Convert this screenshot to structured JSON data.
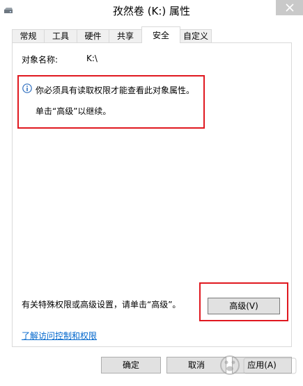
{
  "window": {
    "title": "孜然卷 (K:) 属性"
  },
  "tabs": [
    {
      "label": "常规"
    },
    {
      "label": "工具"
    },
    {
      "label": "硬件"
    },
    {
      "label": "共享"
    },
    {
      "label": "安全",
      "active": true
    },
    {
      "label": "自定义"
    }
  ],
  "security": {
    "object_name_label": "对象名称:",
    "object_name_value": "K:\\",
    "message": "你必须具有读取权限才能查看此对象属性。",
    "instruction": "单击“高级”以继续。",
    "advanced_hint": "有关特殊权限或高级设置，请单击“高级”。",
    "advanced_button": "高级(V)",
    "learn_link": "了解访问控制和权限"
  },
  "footer": {
    "ok": "确定",
    "cancel": "取消",
    "apply": "应用(A)"
  },
  "colors": {
    "annotation": "#e0181f",
    "link": "#0066cc",
    "info_icon": "#2f6fbf"
  },
  "icons": {
    "title": "drive-icon",
    "close": "close-icon",
    "info": "info-icon"
  }
}
